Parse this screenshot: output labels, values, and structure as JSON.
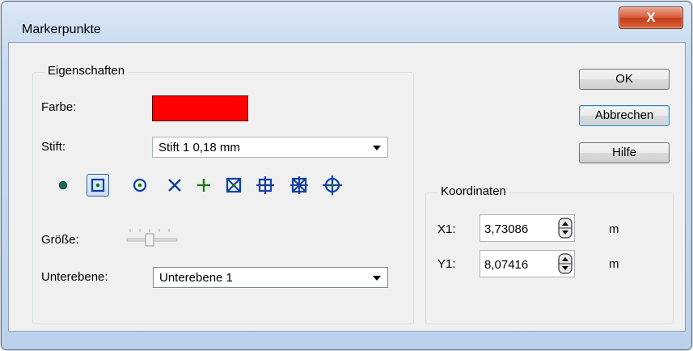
{
  "window": {
    "title": "Markerpunkte",
    "close_glyph": "X"
  },
  "properties": {
    "group_title": "Eigenschaften",
    "color_label": "Farbe:",
    "color_value": "#ff0000",
    "pen_label": "Stift:",
    "pen_value": "Stift 1   0,18 mm",
    "marker_icons": [
      "dot-icon",
      "square-dot-icon",
      "circle-dot-icon",
      "x-icon",
      "plus-icon",
      "boxed-x-icon",
      "boxed-plus-icon",
      "boxed-x-plus-icon",
      "circle-plus-icon"
    ],
    "selected_marker": 1,
    "size_label": "Größe:",
    "sublayer_label": "Unterebene:",
    "sublayer_value": "Unterebene 1"
  },
  "coordinates": {
    "group_title": "Koordinaten",
    "x_label": "X1:",
    "x_value": "3,73086",
    "x_unit": "m",
    "y_label": "Y1:",
    "y_value": "8,07416",
    "y_unit": "m"
  },
  "buttons": {
    "ok": "OK",
    "cancel": "Abbrechen",
    "help": "Hilfe"
  },
  "colors": {
    "marker_fill": "#1040a0",
    "marker_center": "#1a7a1a"
  }
}
